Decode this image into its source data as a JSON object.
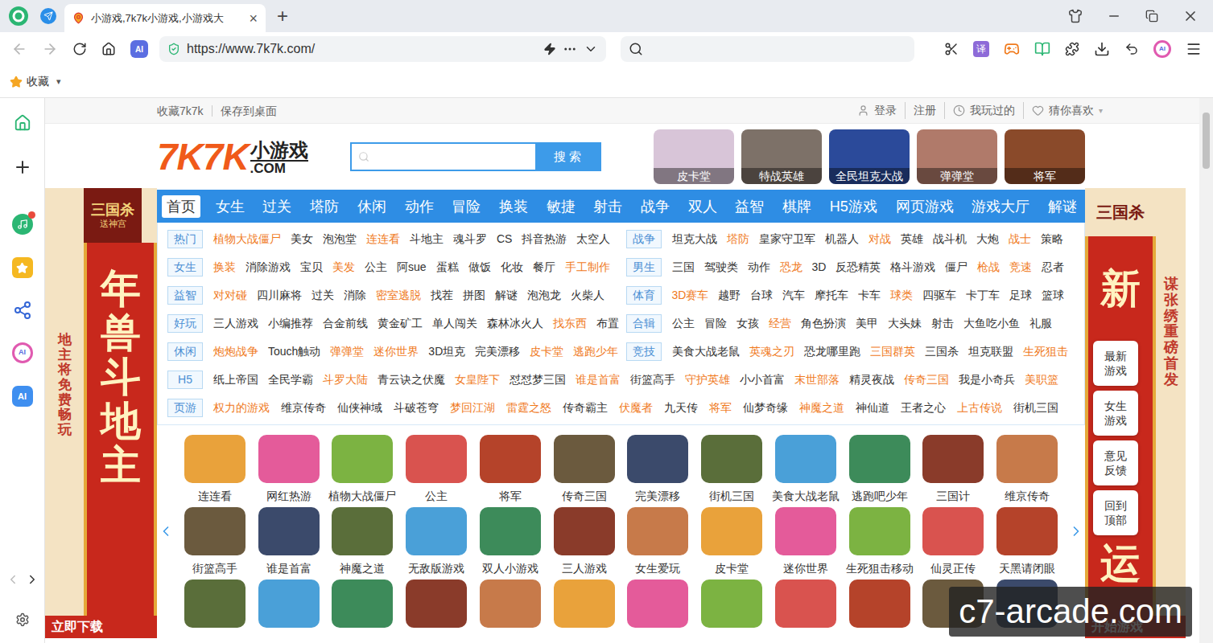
{
  "browser": {
    "tab": {
      "title": "小游戏,7k7k小游戏,小游戏大",
      "close": "×",
      "selected": true
    },
    "new_tab": "+",
    "back_enabled": false,
    "forward_enabled": false,
    "address_badge": "AI",
    "url": "https://www.7k7k.com/",
    "translate_button": "译",
    "toolbar_ai": "AI",
    "bookmarks": [
      {
        "label": "收藏",
        "caret": "▾"
      }
    ],
    "sidebar_ai_labels": [
      "AI",
      "AI"
    ]
  },
  "page": {
    "top_links": [
      "收藏7k7k",
      "保存到桌面"
    ],
    "user_links": [
      {
        "label": "登录",
        "kind": "user",
        "caret": ""
      },
      {
        "label": "注册",
        "kind": "plain",
        "caret": ""
      },
      {
        "label": "我玩过的",
        "kind": "clock",
        "caret": ""
      },
      {
        "label": "猜你喜欢",
        "kind": "heart",
        "caret": "▾"
      }
    ],
    "logo": {
      "brand": "7K7K",
      "sub": "小游戏",
      "domain": ".COM"
    },
    "search": {
      "button": "搜索"
    },
    "featured": [
      "皮卡堂",
      "特战英雄",
      "全民坦克大战",
      "弹弹堂",
      "将军"
    ],
    "nav": [
      {
        "label": "首页",
        "selected": true
      },
      {
        "label": "女生",
        "selected": false
      },
      {
        "label": "过关",
        "selected": false
      },
      {
        "label": "塔防",
        "selected": false
      },
      {
        "label": "休闲",
        "selected": false
      },
      {
        "label": "动作",
        "selected": false
      },
      {
        "label": "冒险",
        "selected": false
      },
      {
        "label": "换装",
        "selected": false
      },
      {
        "label": "敏捷",
        "selected": false
      },
      {
        "label": "射击",
        "selected": false
      },
      {
        "label": "战争",
        "selected": false
      },
      {
        "label": "双人",
        "selected": false
      },
      {
        "label": "益智",
        "selected": false
      },
      {
        "label": "棋牌",
        "selected": false
      },
      {
        "label": "H5游戏",
        "selected": false
      },
      {
        "label": "网页游戏",
        "selected": false
      },
      {
        "label": "游戏大厅",
        "selected": false
      },
      {
        "label": "解谜",
        "selected": false
      }
    ],
    "categories_paired": [
      [
        {
          "label": "热门",
          "items": [
            {
              "text": "植物大战僵尸",
              "hot": true
            },
            {
              "text": "美女",
              "hot": false
            },
            {
              "text": "泡泡堂",
              "hot": false
            },
            {
              "text": "连连看",
              "hot": true
            },
            {
              "text": "斗地主",
              "hot": false
            },
            {
              "text": "魂斗罗",
              "hot": false
            },
            {
              "text": "CS",
              "hot": false
            },
            {
              "text": "抖音热游",
              "hot": false
            },
            {
              "text": "太空人",
              "hot": false
            }
          ]
        },
        {
          "label": "战争",
          "items": [
            {
              "text": "坦克大战",
              "hot": false
            },
            {
              "text": "塔防",
              "hot": true
            },
            {
              "text": "皇家守卫军",
              "hot": false
            },
            {
              "text": "机器人",
              "hot": false
            },
            {
              "text": "对战",
              "hot": true
            },
            {
              "text": "英雄",
              "hot": false
            },
            {
              "text": "战斗机",
              "hot": false
            },
            {
              "text": "大炮",
              "hot": false
            },
            {
              "text": "战士",
              "hot": true
            },
            {
              "text": "策略",
              "hot": false
            }
          ]
        }
      ],
      [
        {
          "label": "女生",
          "items": [
            {
              "text": "换装",
              "hot": true
            },
            {
              "text": "消除游戏",
              "hot": false
            },
            {
              "text": "宝贝",
              "hot": false
            },
            {
              "text": "美发",
              "hot": true
            },
            {
              "text": "公主",
              "hot": false
            },
            {
              "text": "阿sue",
              "hot": false
            },
            {
              "text": "蛋糕",
              "hot": false
            },
            {
              "text": "做饭",
              "hot": false
            },
            {
              "text": "化妆",
              "hot": false
            },
            {
              "text": "餐厅",
              "hot": false
            },
            {
              "text": "手工制作",
              "hot": true
            }
          ]
        },
        {
          "label": "男生",
          "items": [
            {
              "text": "三国",
              "hot": false
            },
            {
              "text": "驾驶类",
              "hot": false
            },
            {
              "text": "动作",
              "hot": false
            },
            {
              "text": "恐龙",
              "hot": true
            },
            {
              "text": "3D",
              "hot": false
            },
            {
              "text": "反恐精英",
              "hot": false
            },
            {
              "text": "格斗游戏",
              "hot": false
            },
            {
              "text": "僵尸",
              "hot": false
            },
            {
              "text": "枪战",
              "hot": true
            },
            {
              "text": "竞速",
              "hot": true
            },
            {
              "text": "忍者",
              "hot": false
            }
          ]
        }
      ],
      [
        {
          "label": "益智",
          "items": [
            {
              "text": "对对碰",
              "hot": true
            },
            {
              "text": "四川麻将",
              "hot": false
            },
            {
              "text": "过关",
              "hot": false
            },
            {
              "text": "消除",
              "hot": false
            },
            {
              "text": "密室逃脱",
              "hot": true
            },
            {
              "text": "找茬",
              "hot": false
            },
            {
              "text": "拼图",
              "hot": false
            },
            {
              "text": "解谜",
              "hot": false
            },
            {
              "text": "泡泡龙",
              "hot": false
            },
            {
              "text": "火柴人",
              "hot": false
            }
          ]
        },
        {
          "label": "体育",
          "items": [
            {
              "text": "3D赛车",
              "hot": true
            },
            {
              "text": "越野",
              "hot": false
            },
            {
              "text": "台球",
              "hot": false
            },
            {
              "text": "汽车",
              "hot": false
            },
            {
              "text": "摩托车",
              "hot": false
            },
            {
              "text": "卡车",
              "hot": false
            },
            {
              "text": "球类",
              "hot": true
            },
            {
              "text": "四驱车",
              "hot": false
            },
            {
              "text": "卡丁车",
              "hot": false
            },
            {
              "text": "足球",
              "hot": false
            },
            {
              "text": "篮球",
              "hot": false
            }
          ]
        }
      ],
      [
        {
          "label": "好玩",
          "items": [
            {
              "text": "三人游戏",
              "hot": false
            },
            {
              "text": "小编推荐",
              "hot": false
            },
            {
              "text": "合金前线",
              "hot": false
            },
            {
              "text": "黄金矿工",
              "hot": false
            },
            {
              "text": "单人闯关",
              "hot": false
            },
            {
              "text": "森林冰火人",
              "hot": false
            },
            {
              "text": "找东西",
              "hot": true
            },
            {
              "text": "布置",
              "hot": false
            }
          ]
        },
        {
          "label": "合辑",
          "items": [
            {
              "text": "公主",
              "hot": false
            },
            {
              "text": "冒险",
              "hot": false
            },
            {
              "text": "女孩",
              "hot": false
            },
            {
              "text": "经营",
              "hot": true
            },
            {
              "text": "角色扮演",
              "hot": false
            },
            {
              "text": "美甲",
              "hot": false
            },
            {
              "text": "大头妹",
              "hot": false
            },
            {
              "text": "射击",
              "hot": false
            },
            {
              "text": "大鱼吃小鱼",
              "hot": false
            },
            {
              "text": "礼服",
              "hot": false
            }
          ]
        }
      ],
      [
        {
          "label": "休闲",
          "items": [
            {
              "text": "炮炮战争",
              "hot": true
            },
            {
              "text": "Touch触动",
              "hot": false
            },
            {
              "text": "弹弹堂",
              "hot": true
            },
            {
              "text": "迷你世界",
              "hot": true
            },
            {
              "text": "3D坦克",
              "hot": false
            },
            {
              "text": "完美漂移",
              "hot": false
            },
            {
              "text": "皮卡堂",
              "hot": true
            },
            {
              "text": "逃跑少年",
              "hot": true
            }
          ]
        },
        {
          "label": "竞技",
          "items": [
            {
              "text": "美食大战老鼠",
              "hot": false
            },
            {
              "text": "英魂之刃",
              "hot": true
            },
            {
              "text": "恐龙哪里跑",
              "hot": false
            },
            {
              "text": "三国群英",
              "hot": true
            },
            {
              "text": "三国杀",
              "hot": false
            },
            {
              "text": "坦克联盟",
              "hot": false
            },
            {
              "text": "生死狙击",
              "hot": true
            }
          ]
        }
      ]
    ],
    "categories_wide": [
      {
        "label": "H5",
        "items": [
          {
            "text": "纸上帝国",
            "hot": false
          },
          {
            "text": "全民学霸",
            "hot": false
          },
          {
            "text": "斗罗大陆",
            "hot": true
          },
          {
            "text": "青云诀之伏魔",
            "hot": false
          },
          {
            "text": "女皇陛下",
            "hot": true
          },
          {
            "text": "怼怼梦三国",
            "hot": false
          },
          {
            "text": "谁是首富",
            "hot": true
          },
          {
            "text": "街篮高手",
            "hot": false
          },
          {
            "text": "守护英雄",
            "hot": true
          },
          {
            "text": "小小首富",
            "hot": false
          },
          {
            "text": "末世部落",
            "hot": true
          },
          {
            "text": "精灵夜战",
            "hot": false
          },
          {
            "text": "传奇三国",
            "hot": true
          },
          {
            "text": "我是小奇兵",
            "hot": false
          },
          {
            "text": "美职篮",
            "hot": true
          }
        ]
      },
      {
        "label": "页游",
        "items": [
          {
            "text": "权力的游戏",
            "hot": true
          },
          {
            "text": "维京传奇",
            "hot": false
          },
          {
            "text": "仙侠神域",
            "hot": false
          },
          {
            "text": "斗破苍穹",
            "hot": false
          },
          {
            "text": "梦回江湖",
            "hot": true
          },
          {
            "text": "雷霆之怒",
            "hot": true
          },
          {
            "text": "传奇霸主",
            "hot": false
          },
          {
            "text": "伏魔者",
            "hot": true
          },
          {
            "text": "九天传",
            "hot": false
          },
          {
            "text": "将军",
            "hot": true
          },
          {
            "text": "仙梦奇缘",
            "hot": false
          },
          {
            "text": "神魔之道",
            "hot": true
          },
          {
            "text": "神仙道",
            "hot": false
          },
          {
            "text": "王者之心",
            "hot": false
          },
          {
            "text": "上古传说",
            "hot": true
          },
          {
            "text": "街机三国",
            "hot": false
          }
        ]
      }
    ],
    "game_rows": [
      [
        "连连看",
        "网红热游",
        "植物大战僵尸",
        "公主",
        "将军",
        "传奇三国",
        "完美漂移",
        "街机三国",
        "美食大战老鼠",
        "逃跑吧少年",
        "三国计",
        "维京传奇"
      ],
      [
        "街篮高手",
        "谁是首富",
        "神魔之道",
        "无敌版游戏",
        "双人小游戏",
        "三人游戏",
        "女生爱玩",
        "皮卡堂",
        "迷你世界",
        "生死狙击移动",
        "仙灵正传",
        "天黑请闭眼"
      ]
    ],
    "banners": {
      "left": {
        "logo": "三国杀",
        "logo_sub": "送神宫",
        "headline": "年兽斗地主",
        "tagline": "地主将免费畅玩",
        "cta": "立即下载"
      },
      "right": {
        "logo": "三国杀",
        "headline_top": "新",
        "headline_bottom": "运",
        "tagline": "谋张绣重磅首发",
        "cta": "开始游戏"
      }
    },
    "float_buttons": [
      "最新游戏",
      "女生游戏",
      "意见反馈",
      "回到顶部"
    ],
    "watermark": "c7-arcade.com"
  }
}
